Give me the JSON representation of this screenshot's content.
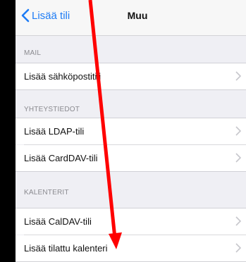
{
  "navbar": {
    "back_label": "Lisää tili",
    "title": "Muu"
  },
  "sections": [
    {
      "header": "MAIL",
      "rows": [
        {
          "label": "Lisää sähköpostitili"
        }
      ]
    },
    {
      "header": "YHTEYSTIEDOT",
      "rows": [
        {
          "label": "Lisää LDAP-tili"
        },
        {
          "label": "Lisää CardDAV-tili"
        }
      ]
    },
    {
      "header": "KALENTERIT",
      "rows": [
        {
          "label": "Lisää CalDAV-tili"
        },
        {
          "label": "Lisää tilattu kalenteri"
        }
      ]
    }
  ],
  "annotation": {
    "arrow_color": "#ff0000"
  },
  "colors": {
    "accent": "#1e7cf5",
    "background": "#efeff4"
  },
  "icons": {
    "back": "chevron-left-icon",
    "row_disclosure": "chevron-right-icon"
  }
}
